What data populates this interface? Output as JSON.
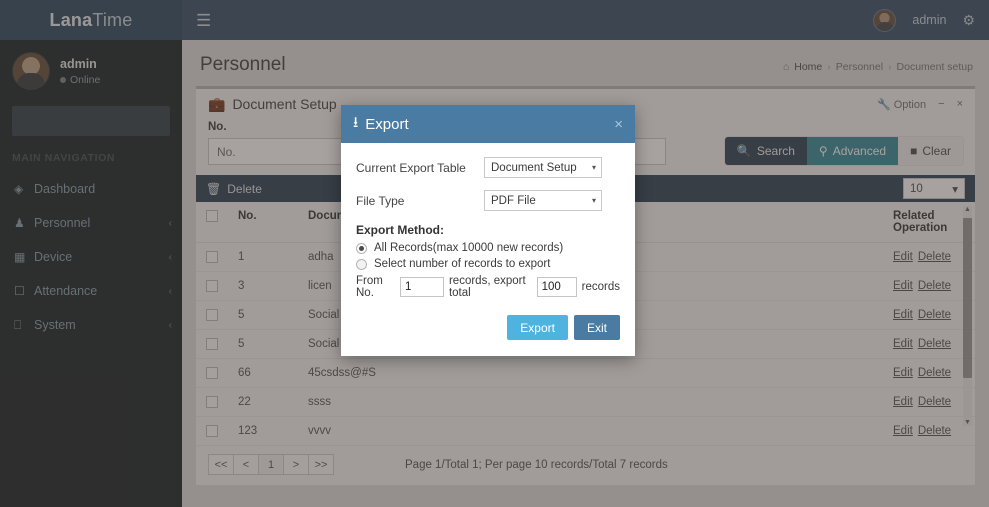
{
  "navbar": {
    "brand_bold": "Lana",
    "brand_light": "Time",
    "hamburger_icon": "hamburger-icon",
    "username": "admin",
    "settings_icon": "gear-icon"
  },
  "sidebar": {
    "user": {
      "name": "admin",
      "status": "Online"
    },
    "search_placeholder": "",
    "nav_title": "MAIN NAVIGATION",
    "items": [
      {
        "label": "Dashboard",
        "icon": "dashboard-icon",
        "caret": ""
      },
      {
        "label": "Personnel",
        "icon": "users-icon",
        "caret": "‹"
      },
      {
        "label": "Device",
        "icon": "device-icon",
        "caret": "‹"
      },
      {
        "label": "Attendance",
        "icon": "calendar-icon",
        "caret": "‹"
      },
      {
        "label": "System",
        "icon": "desktop-icon",
        "caret": "‹"
      }
    ]
  },
  "content_header": {
    "title": "Personnel",
    "breadcrumb": {
      "home": "Home",
      "level2": "Personnel",
      "level3": "Document setup",
      "sep": "›"
    }
  },
  "panel": {
    "title": "Document Setup",
    "title_icon": "briefcase-icon",
    "option_label": "Option",
    "option_icon": "wrench-icon",
    "minimize_icon": "minimize-icon",
    "close_icon": "close-icon"
  },
  "filters": {
    "no_label": "No.",
    "no_value": "",
    "no_placeholder": "No.",
    "search_label": "Search",
    "search_icon": "search-icon",
    "advanced_label": "Advanced",
    "advanced_icon": "binoculars-icon",
    "clear_label": "Clear",
    "clear_icon": "eraser-icon"
  },
  "table_toolbar": {
    "delete_label": "Delete",
    "delete_icon": "trash-icon",
    "per_page_value": "10",
    "per_page_caret": "▾"
  },
  "table": {
    "columns": [
      "",
      "No.",
      "Document Name",
      "Related Operation"
    ],
    "rows": [
      {
        "no": "1",
        "doc": "adha",
        "edit": "Edit",
        "delete": "Delete"
      },
      {
        "no": "3",
        "doc": "licen",
        "edit": "Edit",
        "delete": "Delete"
      },
      {
        "no": "5",
        "doc": "Social Number Security",
        "edit": "Edit",
        "delete": "Delete"
      },
      {
        "no": "5",
        "doc": "Social Number Security",
        "edit": "Edit",
        "delete": "Delete"
      },
      {
        "no": "66",
        "doc": "45csdss@#S",
        "edit": "Edit",
        "delete": "Delete"
      },
      {
        "no": "22",
        "doc": "ssss",
        "edit": "Edit",
        "delete": "Delete"
      },
      {
        "no": "123",
        "doc": "vvvv",
        "edit": "Edit",
        "delete": "Delete"
      }
    ]
  },
  "pagination": {
    "first": "<<",
    "prev": "<",
    "page": "1",
    "next": ">",
    "last": ">>",
    "info": "Page 1/Total 1; Per page 10 records/Total 7 records"
  },
  "modal": {
    "title": "Export",
    "title_icon": "download-icon",
    "close_icon": "close-icon",
    "current_table_label": "Current Export Table",
    "current_table_value": "Document Setup",
    "file_type_label": "File Type",
    "file_type_value": "PDF File",
    "caret": "▾",
    "export_method_label": "Export Method:",
    "option_all": "All Records(max 10000 new records)",
    "option_select": "Select number of records to export",
    "from_label": "From No.",
    "from_value": "1",
    "mid_label": "records, export total",
    "total_value": "100",
    "tail_label": "records",
    "export_button": "Export",
    "exit_button": "Exit"
  },
  "colors": {
    "navbar": "#3c5770",
    "sidebar": "#222d32",
    "modal_header": "#4a7ba3",
    "export_button": "#4fb3e0",
    "advanced_button": "#3c8ea0",
    "table_bar": "#36495e"
  }
}
